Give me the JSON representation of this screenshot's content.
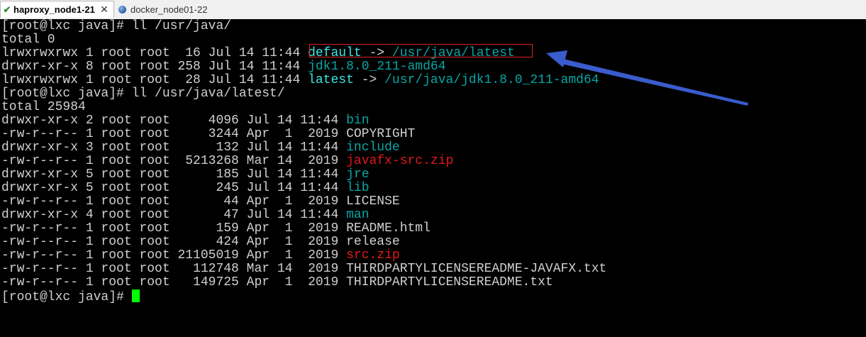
{
  "tabs": [
    {
      "label": "haproxy_node1-21",
      "active": true,
      "icon": "check-icon"
    },
    {
      "label": "docker_node01-22",
      "active": false,
      "icon": "globe-icon"
    }
  ],
  "colors": {
    "background": "#000000",
    "text": "#d0d0d0",
    "directory": "#0aa5a5",
    "symlink": "#3ee6e6",
    "archive": "#e01a1a",
    "cursor": "#00ff00",
    "highlight_box": "#e02020",
    "arrow": "#3a5ccc"
  },
  "terminal": {
    "lines": [
      {
        "segments": [
          {
            "text": "[root@lxc java]# ll /usr/java/",
            "color": "white"
          }
        ]
      },
      {
        "segments": [
          {
            "text": "total 0",
            "color": "white"
          }
        ]
      },
      {
        "segments": [
          {
            "text": "lrwxrwxrwx 1 root root  16 Jul 14 11:44 ",
            "color": "white"
          },
          {
            "text": "default",
            "color": "bright"
          },
          {
            "text": " -> ",
            "color": "white"
          },
          {
            "text": "/usr/java/latest",
            "color": "cyan"
          }
        ]
      },
      {
        "segments": [
          {
            "text": "drwxr-xr-x 8 root root 258 Jul 14 11:44 ",
            "color": "white"
          },
          {
            "text": "jdk1.8.0_211-amd64",
            "color": "cyan"
          }
        ]
      },
      {
        "segments": [
          {
            "text": "lrwxrwxrwx 1 root root  28 Jul 14 11:44 ",
            "color": "white"
          },
          {
            "text": "latest",
            "color": "bright"
          },
          {
            "text": " -> ",
            "color": "white"
          },
          {
            "text": "/usr/java/jdk1.8.0_211-amd64",
            "color": "cyan"
          }
        ]
      },
      {
        "segments": [
          {
            "text": "[root@lxc java]# ll /usr/java/latest/",
            "color": "white"
          }
        ]
      },
      {
        "segments": [
          {
            "text": "total 25984",
            "color": "white"
          }
        ]
      },
      {
        "segments": [
          {
            "text": "drwxr-xr-x 2 root root     4096 Jul 14 11:44 ",
            "color": "white"
          },
          {
            "text": "bin",
            "color": "cyan"
          }
        ]
      },
      {
        "segments": [
          {
            "text": "-rw-r--r-- 1 root root     3244 Apr  1  2019 COPYRIGHT",
            "color": "white"
          }
        ]
      },
      {
        "segments": [
          {
            "text": "drwxr-xr-x 3 root root      132 Jul 14 11:44 ",
            "color": "white"
          },
          {
            "text": "include",
            "color": "cyan"
          }
        ]
      },
      {
        "segments": [
          {
            "text": "-rw-r--r-- 1 root root  5213268 Mar 14  2019 ",
            "color": "white"
          },
          {
            "text": "javafx-src.zip",
            "color": "red"
          }
        ]
      },
      {
        "segments": [
          {
            "text": "drwxr-xr-x 5 root root      185 Jul 14 11:44 ",
            "color": "white"
          },
          {
            "text": "jre",
            "color": "cyan"
          }
        ]
      },
      {
        "segments": [
          {
            "text": "drwxr-xr-x 5 root root      245 Jul 14 11:44 ",
            "color": "white"
          },
          {
            "text": "lib",
            "color": "cyan"
          }
        ]
      },
      {
        "segments": [
          {
            "text": "-rw-r--r-- 1 root root       44 Apr  1  2019 LICENSE",
            "color": "white"
          }
        ]
      },
      {
        "segments": [
          {
            "text": "drwxr-xr-x 4 root root       47 Jul 14 11:44 ",
            "color": "white"
          },
          {
            "text": "man",
            "color": "cyan"
          }
        ]
      },
      {
        "segments": [
          {
            "text": "-rw-r--r-- 1 root root      159 Apr  1  2019 README.html",
            "color": "white"
          }
        ]
      },
      {
        "segments": [
          {
            "text": "-rw-r--r-- 1 root root      424 Apr  1  2019 release",
            "color": "white"
          }
        ]
      },
      {
        "segments": [
          {
            "text": "-rw-r--r-- 1 root root 21105019 Apr  1  2019 ",
            "color": "white"
          },
          {
            "text": "src.zip",
            "color": "red"
          }
        ]
      },
      {
        "segments": [
          {
            "text": "-rw-r--r-- 1 root root   112748 Mar 14  2019 THIRDPARTYLICENSEREADME-JAVAFX.txt",
            "color": "white"
          }
        ]
      },
      {
        "segments": [
          {
            "text": "-rw-r--r-- 1 root root   149725 Apr  1  2019 THIRDPARTYLICENSEREADME.txt",
            "color": "white"
          }
        ]
      },
      {
        "segments": [
          {
            "text": "[root@lxc java]# ",
            "color": "white"
          }
        ],
        "cursor": true
      }
    ]
  }
}
